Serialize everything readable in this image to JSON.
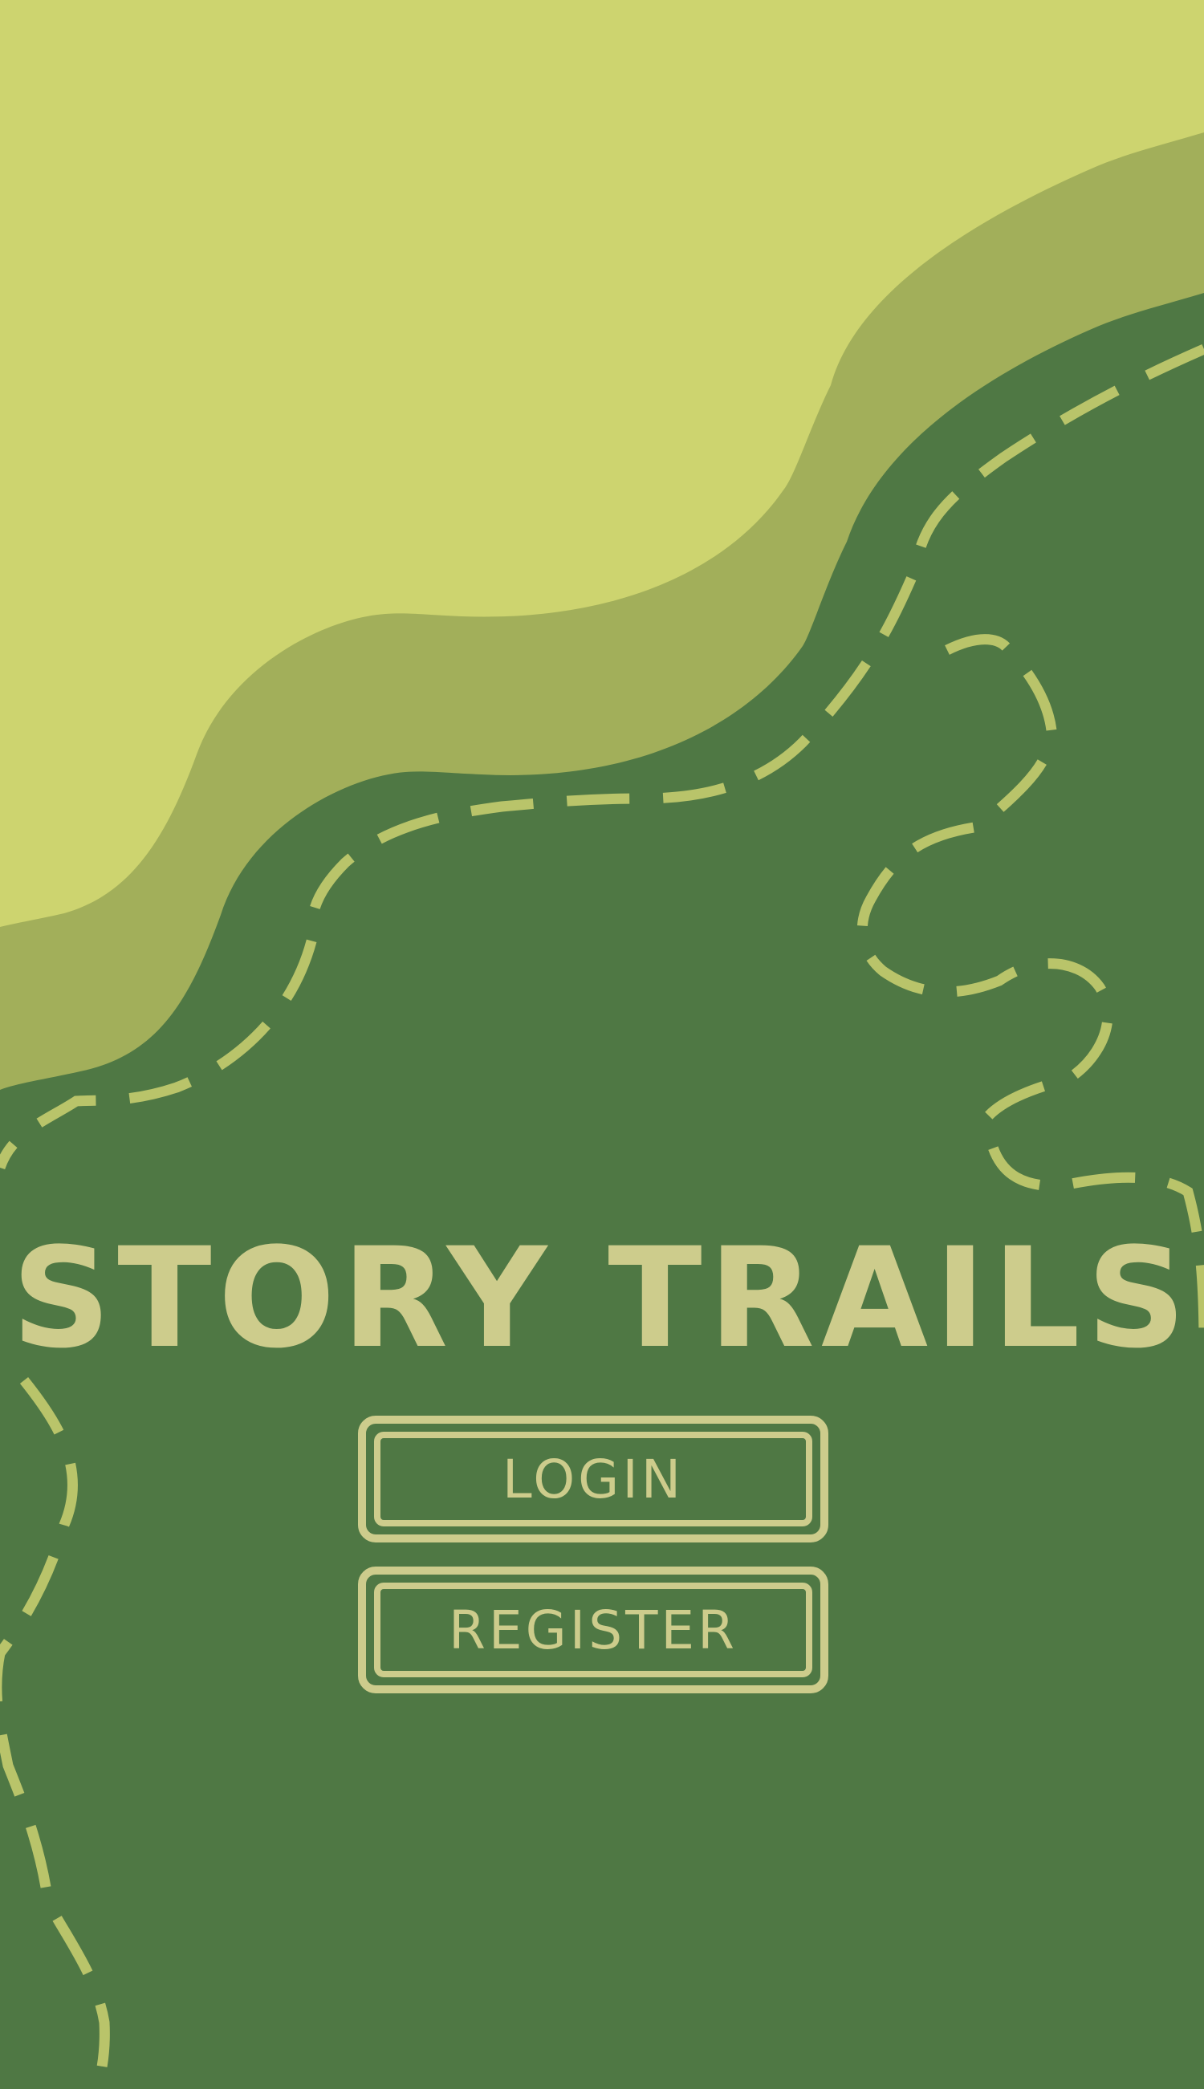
{
  "app": {
    "title": "STORY TRAILS"
  },
  "buttons": {
    "login_label": "LOGIN",
    "register_label": "REGISTER"
  },
  "colors": {
    "background": "#4f7844",
    "hill_light": "#cdd46f",
    "hill_mid": "#a2af5a",
    "trail": "#b9c46a",
    "text": "#cdcc8c"
  }
}
